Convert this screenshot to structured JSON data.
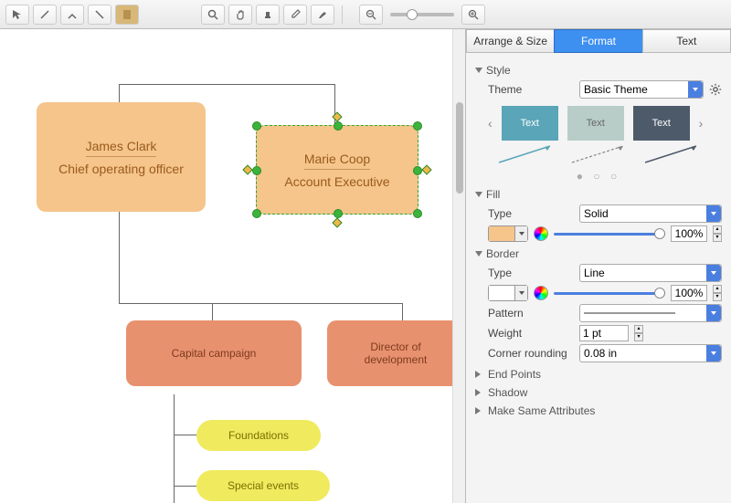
{
  "toolbar": {
    "tools": [
      "select-tool",
      "line-tool",
      "connector-tool",
      "line-alt-tool",
      "doc-tool"
    ],
    "view_tools": [
      "zoom-tool",
      "pan-tool",
      "stamp-tool",
      "eyedropper-tool",
      "brush-tool"
    ]
  },
  "canvas": {
    "nodes": [
      {
        "id": "james",
        "name": "James Clark",
        "role": "Chief operating officer"
      },
      {
        "id": "marie",
        "name": "Marie Coop",
        "role": "Account Executive"
      },
      {
        "id": "capital",
        "label": "Capital campaign"
      },
      {
        "id": "director",
        "label": "Director of development"
      },
      {
        "id": "foundations",
        "label": "Foundations"
      },
      {
        "id": "events",
        "label": "Special events"
      }
    ]
  },
  "sidebar": {
    "tabs": [
      "Arrange & Size",
      "Format",
      "Text"
    ],
    "style": {
      "header": "Style",
      "theme_label": "Theme",
      "theme_value": "Basic Theme",
      "swatches": [
        {
          "bg": "#5aa5b8",
          "txt": "Text"
        },
        {
          "bg": "#b8cdc7",
          "txt": "Text"
        },
        {
          "bg": "#4d5a6a",
          "txt": "Text"
        }
      ]
    },
    "fill": {
      "header": "Fill",
      "type_label": "Type",
      "type_value": "Solid",
      "percent": "100%"
    },
    "border": {
      "header": "Border",
      "type_label": "Type",
      "type_value": "Line",
      "percent": "100%",
      "pattern_label": "Pattern",
      "weight_label": "Weight",
      "weight_value": "1 pt",
      "corner_label": "Corner rounding",
      "corner_value": "0.08 in"
    },
    "collapsed": [
      "End Points",
      "Shadow",
      "Make Same Attributes"
    ]
  }
}
